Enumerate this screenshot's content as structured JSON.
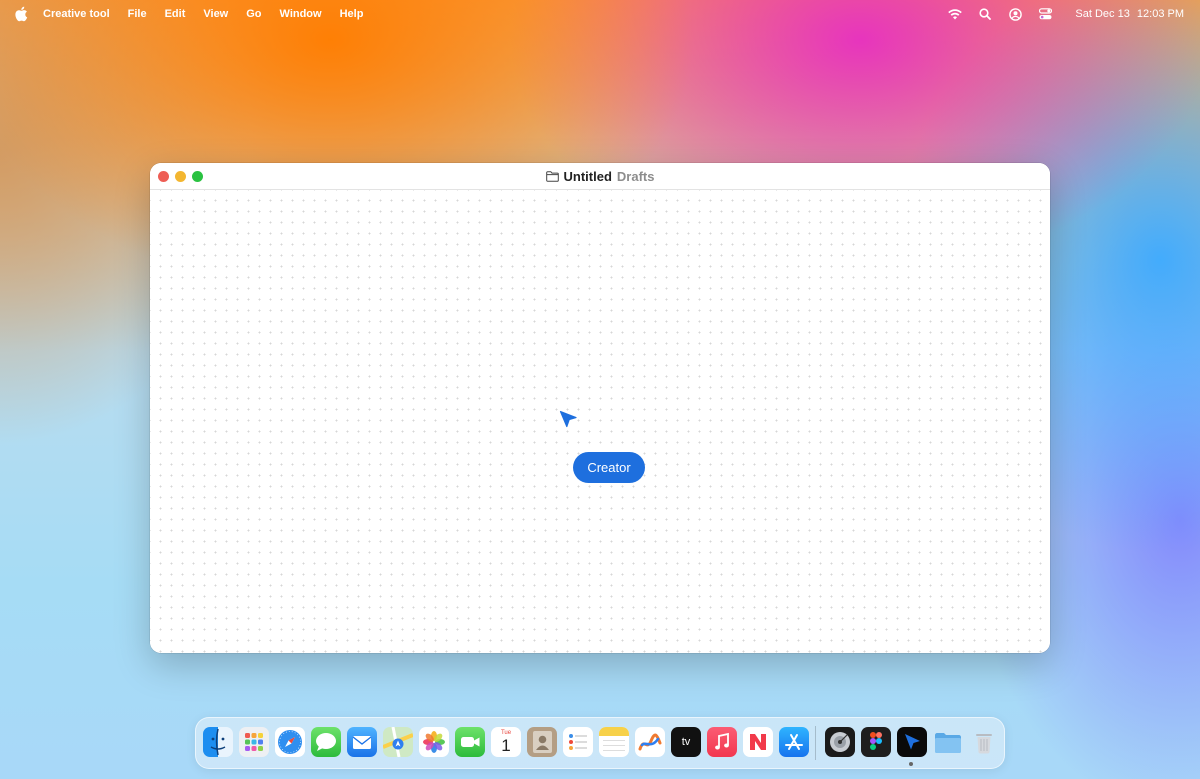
{
  "menubar": {
    "apple_icon": "apple-logo-icon",
    "app_name": "Creative tool",
    "items": [
      "File",
      "Edit",
      "View",
      "Go",
      "Window",
      "Help"
    ],
    "status_icons": [
      "wifi-icon",
      "search-icon",
      "user-icon",
      "control-center-icon"
    ],
    "date": "Sat Dec 13",
    "time": "12:03 PM"
  },
  "window": {
    "folder_icon": "folder-icon",
    "doc_name": "Untitled",
    "doc_location": "Drafts",
    "cursor_icon": "pointer-cursor-icon",
    "collaborator_label": "Creator",
    "accent_color": "#1e6fde"
  },
  "dock": {
    "apps": [
      {
        "name": "Finder",
        "icon": "finder-icon"
      },
      {
        "name": "Launchpad",
        "icon": "launchpad-icon"
      },
      {
        "name": "Safari",
        "icon": "safari-icon"
      },
      {
        "name": "Messages",
        "icon": "messages-icon"
      },
      {
        "name": "Mail",
        "icon": "mail-icon"
      },
      {
        "name": "Maps",
        "icon": "maps-icon"
      },
      {
        "name": "Photos",
        "icon": "photos-icon"
      },
      {
        "name": "FaceTime",
        "icon": "facetime-icon"
      },
      {
        "name": "Calendar",
        "icon": "calendar-icon",
        "month": "Tue",
        "day": "1"
      },
      {
        "name": "Contacts",
        "icon": "contacts-icon"
      },
      {
        "name": "Reminders",
        "icon": "reminders-icon"
      },
      {
        "name": "Notes",
        "icon": "notes-icon"
      },
      {
        "name": "Freeform",
        "icon": "freeform-icon"
      },
      {
        "name": "TV",
        "icon": "apple-tv-icon",
        "label": "tv"
      },
      {
        "name": "Music",
        "icon": "music-icon"
      },
      {
        "name": "News",
        "icon": "news-icon"
      },
      {
        "name": "App Store",
        "icon": "app-store-icon"
      },
      {
        "name": "Disk Utility",
        "icon": "disk-utility-icon"
      },
      {
        "name": "Figma",
        "icon": "figma-icon"
      },
      {
        "name": "Creative tool",
        "icon": "creative-tool-icon",
        "running": true
      },
      {
        "name": "Folder",
        "icon": "folder-stack-icon"
      },
      {
        "name": "Trash",
        "icon": "trash-icon"
      }
    ]
  }
}
